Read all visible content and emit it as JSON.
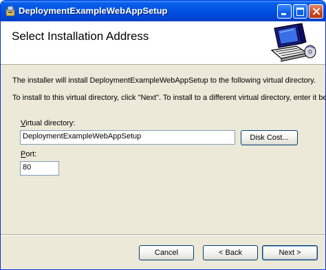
{
  "window": {
    "title": "DeploymentExampleWebAppSetup",
    "icon": "installer-icon",
    "controls": [
      "minimize-icon",
      "maximize-icon",
      "close-icon"
    ]
  },
  "banner": {
    "title": "Select Installation Address",
    "graphic": "computer-with-cd-icon"
  },
  "body": {
    "description_line1": "The installer will install DeploymentExampleWebAppSetup to the following virtual directory.",
    "description_line2": "To install to this virtual directory, click \"Next\". To install to a different virtual directory, enter it below.",
    "virtual_directory": {
      "label_access": "V",
      "label_rest": "irtual directory:",
      "value": "DeploymentExampleWebAppSetup"
    },
    "port": {
      "label_access": "P",
      "label_rest": "ort:",
      "value": "80"
    },
    "disk_cost_label": "Disk Cost..."
  },
  "footer": {
    "cancel_label": "Cancel",
    "back_label": "< Back",
    "next_label": "Next >"
  },
  "colors": {
    "titlebar": "#0054e3",
    "dialog_face": "#ece9d8",
    "textbox_border": "#7f9db9"
  }
}
